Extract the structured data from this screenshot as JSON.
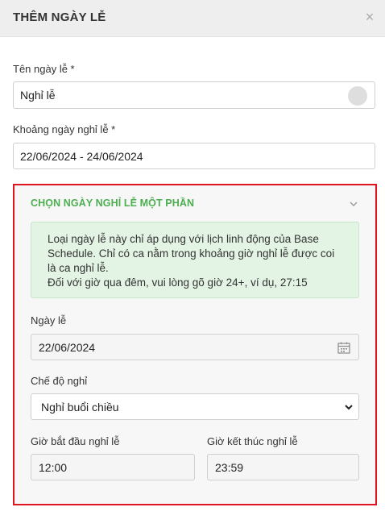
{
  "header": {
    "title": "THÊM NGÀY LỄ",
    "close_glyph": "×"
  },
  "holiday_name": {
    "label": "Tên ngày lễ *",
    "value": "Nghỉ lễ"
  },
  "holiday_range": {
    "label": "Khoảng ngày nghỉ lễ *",
    "value": "22/06/2024 - 24/06/2024"
  },
  "partial": {
    "title": "CHỌN NGÀY NGHỈ LỄ MỘT PHẦN",
    "info_lines": [
      "Loại ngày lễ này chỉ áp dụng với lịch linh động của Base",
      "Schedule. Chỉ có ca nằm trong khoảng giờ nghỉ lễ được coi",
      "là ca nghỉ lễ.",
      "Đối với giờ qua đêm, vui lòng gõ giờ 24+, ví dụ, 27:15"
    ],
    "date_label": "Ngày lễ",
    "date_value": "22/06/2024",
    "mode_label": "Chế độ nghỉ",
    "mode_value": "Nghỉ buổi chiều",
    "start_label": "Giờ bắt đầu nghỉ lễ",
    "start_value": "12:00",
    "end_label": "Giờ kết thúc nghỉ lễ",
    "end_value": "23:59"
  },
  "colors": {
    "accent_green": "#4caf50",
    "highlight_red": "#e0141e",
    "info_bg": "#e3f3e4"
  },
  "icons": [
    "close-icon",
    "toggle-indicator",
    "chevron-down-icon",
    "calendar-icon",
    "dropdown-arrow-icon"
  ]
}
